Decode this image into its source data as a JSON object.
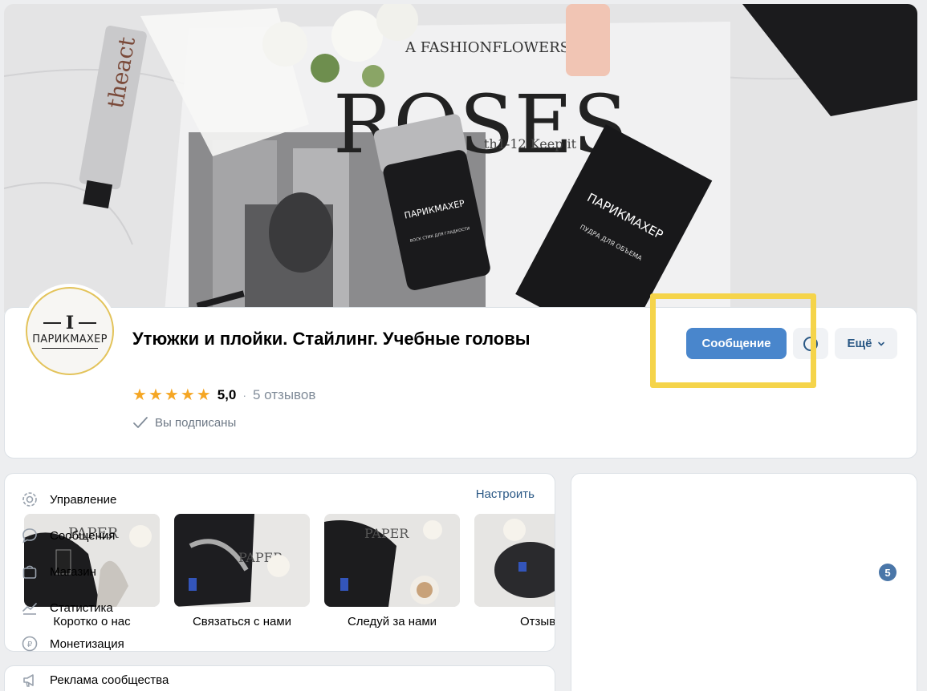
{
  "group": {
    "title": "Утюжки и плойки. Стайлинг. Учебные головы",
    "rating_value": "5,0",
    "reviews_link": "5 отзывов",
    "subscribed_text": "Вы подписаны",
    "avatar_letter": "I",
    "avatar_brand": "ПАРИКМАХЕР"
  },
  "cover": {
    "magazine_word": "ROSES",
    "magazine_line": "A FASHIONFLOWERS",
    "magazine_sub": "th1-12 Keep it",
    "tube_text": "theact",
    "product_brand": "ПАРИКМАХЕР",
    "box_caption": "ПУДРА ДЛЯ ОБЪЕМА",
    "stick_caption": "ВОСК СТИК ДЛЯ ГЛАДКОСТИ"
  },
  "actions": {
    "message_button": "Сообщение",
    "more_button": "Ещё"
  },
  "widgets": {
    "configure_link": "Настроить",
    "tiles": [
      {
        "label": "Коротко о нас"
      },
      {
        "label": "Связаться с нами"
      },
      {
        "label": "Следуй за нами"
      },
      {
        "label": "Отзывы"
      }
    ]
  },
  "menu": {
    "items": [
      {
        "label": "Управление",
        "icon": "gear-icon"
      },
      {
        "label": "Сообщения",
        "icon": "message-icon"
      },
      {
        "label": "Магазин",
        "icon": "shop-bag-icon",
        "badge": "5"
      },
      {
        "label": "Статистика",
        "icon": "stats-icon"
      },
      {
        "label": "Монетизация",
        "icon": "ruble-icon"
      },
      {
        "label": "Реклама сообщества",
        "icon": "megaphone-icon"
      }
    ]
  },
  "colors": {
    "accent": "#4986cc",
    "link": "#2a5885",
    "highlight": "#f5d44a",
    "star": "#f5a623",
    "badge": "#4a76a8"
  }
}
